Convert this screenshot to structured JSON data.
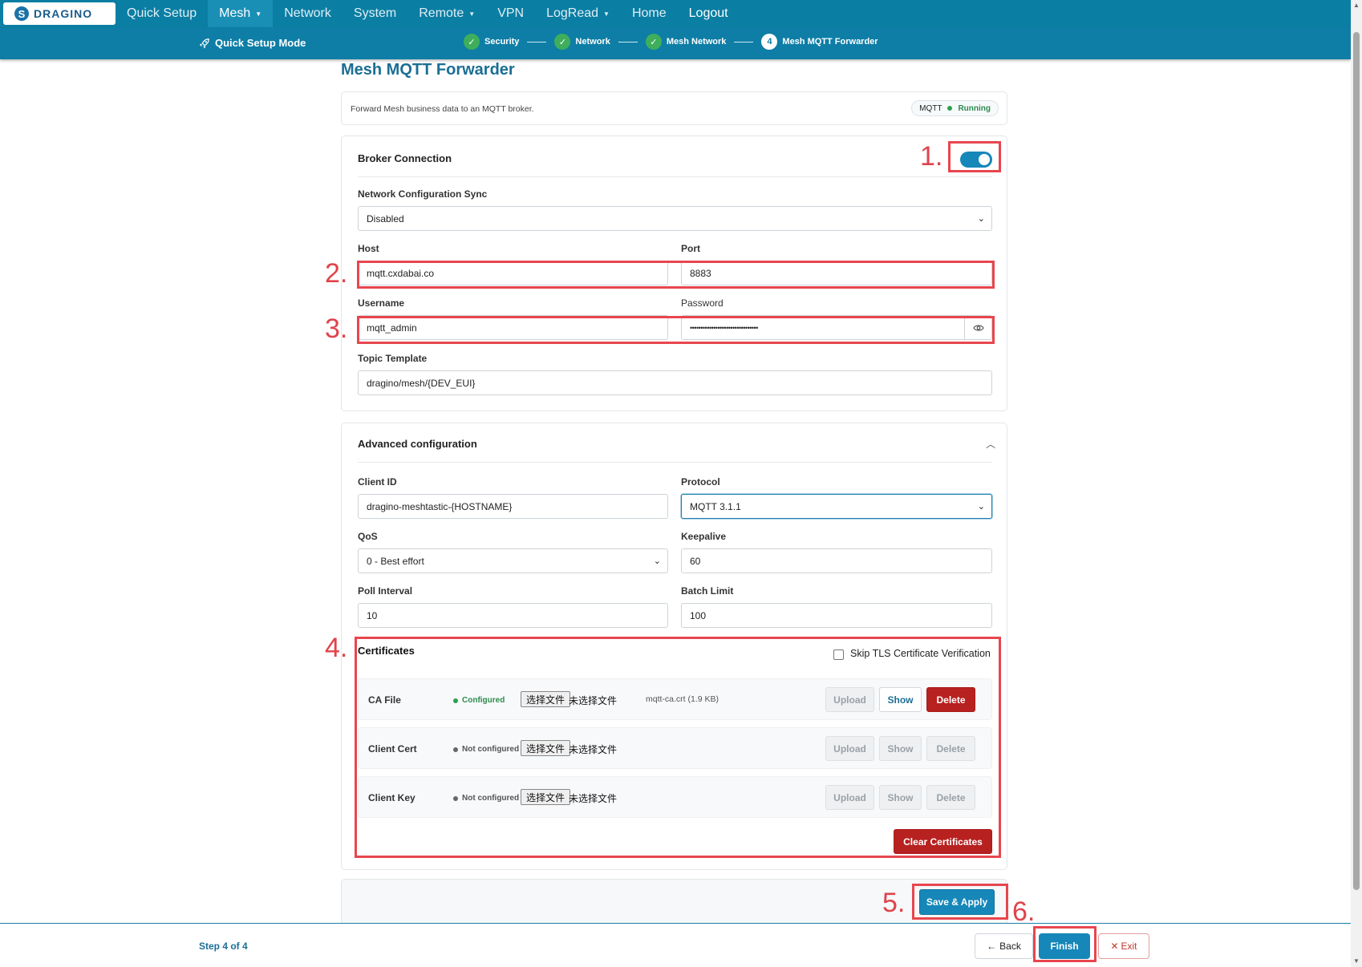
{
  "nav": {
    "logo_text": "DRAGINO",
    "items": [
      {
        "label": "Quick Setup",
        "dropdown": false
      },
      {
        "label": "Mesh",
        "dropdown": true
      },
      {
        "label": "Network",
        "dropdown": false
      },
      {
        "label": "System",
        "dropdown": false
      },
      {
        "label": "Remote",
        "dropdown": true
      },
      {
        "label": "VPN",
        "dropdown": false
      },
      {
        "label": "LogRead",
        "dropdown": true
      },
      {
        "label": "Home",
        "dropdown": false
      }
    ],
    "logout": "Logout",
    "active_item": "Mesh"
  },
  "wizard": {
    "mode_label": "Quick Setup Mode",
    "steps": [
      {
        "label": "Security",
        "marker": "✓",
        "state": "done"
      },
      {
        "label": "Network",
        "marker": "✓",
        "state": "done"
      },
      {
        "label": "Mesh Network",
        "marker": "✓",
        "state": "done"
      },
      {
        "label": "Mesh MQTT Forwarder",
        "marker": "4",
        "state": "current"
      }
    ],
    "step_count": "Step 4 of 4"
  },
  "page": {
    "title": "Mesh MQTT Forwarder",
    "description": "Forward Mesh business data to an MQTT broker.",
    "status_service": "MQTT",
    "status_value": "Running"
  },
  "broker": {
    "title": "Broker Connection",
    "enabled": true,
    "sync_label": "Network Configuration Sync",
    "sync_value": "Disabled",
    "host_label": "Host",
    "host_value": "mqtt.cxdabai.co",
    "port_label": "Port",
    "port_value": "8883",
    "username_label": "Username",
    "username_value": "mqtt_admin",
    "password_label": "Password",
    "password_value": "••••••••••••••••••••••••••••••••",
    "topic_label": "Topic Template",
    "topic_value": "dragino/mesh/{DEV_EUI}"
  },
  "advanced": {
    "title": "Advanced configuration",
    "client_id_label": "Client ID",
    "client_id_value": "dragino-meshtastic-{HOSTNAME}",
    "protocol_label": "Protocol",
    "protocol_value": "MQTT 3.1.1",
    "qos_label": "QoS",
    "qos_value": "0 - Best effort",
    "keepalive_label": "Keepalive",
    "keepalive_value": "60",
    "poll_label": "Poll Interval",
    "poll_value": "10",
    "batch_label": "Batch Limit",
    "batch_value": "100"
  },
  "certificates": {
    "title": "Certificates",
    "skip_tls_label": "Skip TLS Certificate Verification",
    "skip_tls_checked": false,
    "choose_file": "选择文件",
    "no_file": "未选择文件",
    "upload": "Upload",
    "show": "Show",
    "delete": "Delete",
    "clear": "Clear Certificates",
    "rows": [
      {
        "name": "CA File",
        "status": "Configured",
        "configured": true,
        "file": "mqtt-ca.crt (1.9 KB)"
      },
      {
        "name": "Client Cert",
        "status": "Not configured",
        "configured": false,
        "file": ""
      },
      {
        "name": "Client Key",
        "status": "Not configured",
        "configured": false,
        "file": ""
      }
    ]
  },
  "actions": {
    "save_apply": "Save & Apply",
    "back": "Back",
    "finish": "Finish",
    "exit": "Exit"
  },
  "annotations": [
    "1.",
    "2.",
    "3.",
    "4.",
    "5.",
    "6."
  ],
  "colors": {
    "nav_bg": "#0b7ea3",
    "primary": "#1687b8",
    "danger": "#b7211f",
    "success": "#2e9f52",
    "annotation_red": "#e8464e"
  },
  "icons": {
    "quick_setup": "rocket-icon",
    "password_toggle": "eye-icon",
    "collapse": "chevron-up-icon",
    "back": "arrow-left-icon",
    "exit": "close-icon"
  }
}
